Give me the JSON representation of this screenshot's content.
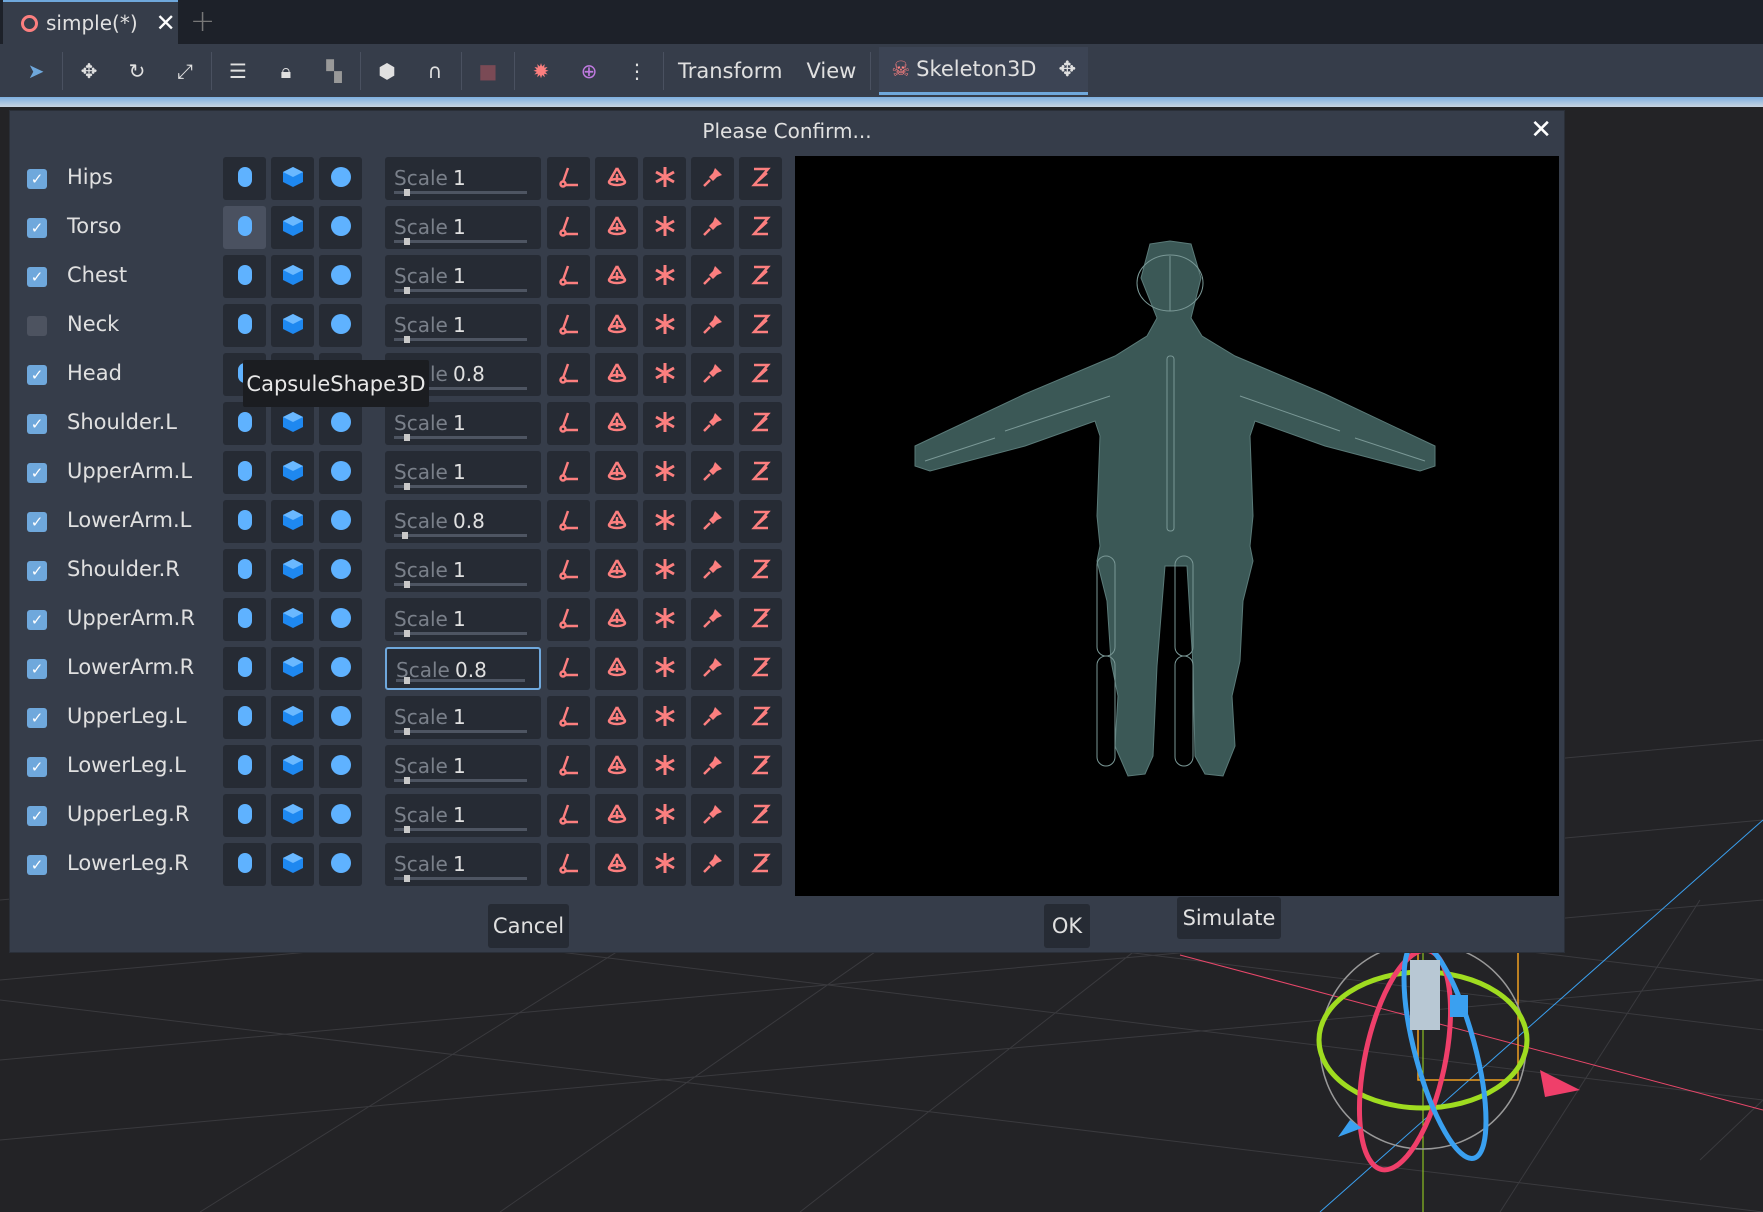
{
  "tabs": [
    {
      "label": "simple(*)",
      "close": "✕"
    }
  ],
  "add_tab": "+",
  "toolbar": {
    "transform": "Transform",
    "view": "View",
    "skeleton": "Skeleton3D"
  },
  "dialog": {
    "title": "Please Confirm...",
    "close": "✕",
    "scale_label": "Scale",
    "tooltip": "CapsuleShape3D",
    "cancel": "Cancel",
    "ok": "OK",
    "simulate": "Simulate",
    "rows": [
      {
        "name": "Hips",
        "checked": true,
        "scale": "1"
      },
      {
        "name": "Torso",
        "checked": true,
        "scale": "1"
      },
      {
        "name": "Chest",
        "checked": true,
        "scale": "1"
      },
      {
        "name": "Neck",
        "checked": false,
        "scale": "1"
      },
      {
        "name": "Head",
        "checked": true,
        "scale": "0.8"
      },
      {
        "name": "Shoulder.L",
        "checked": true,
        "scale": "1"
      },
      {
        "name": "UpperArm.L",
        "checked": true,
        "scale": "1"
      },
      {
        "name": "LowerArm.L",
        "checked": true,
        "scale": "0.8"
      },
      {
        "name": "Shoulder.R",
        "checked": true,
        "scale": "1"
      },
      {
        "name": "UpperArm.R",
        "checked": true,
        "scale": "1"
      },
      {
        "name": "LowerArm.R",
        "checked": true,
        "scale": "0.8"
      },
      {
        "name": "UpperLeg.L",
        "checked": true,
        "scale": "1"
      },
      {
        "name": "LowerLeg.L",
        "checked": true,
        "scale": "1"
      },
      {
        "name": "UpperLeg.R",
        "checked": true,
        "scale": "1"
      },
      {
        "name": "LowerLeg.R",
        "checked": true,
        "scale": "1"
      }
    ]
  },
  "colors": {
    "accent": "#6fa8dc",
    "joint_icon": "#fc7f7f",
    "shape_icon": "#5fb2ff",
    "body": "#3b5856"
  }
}
